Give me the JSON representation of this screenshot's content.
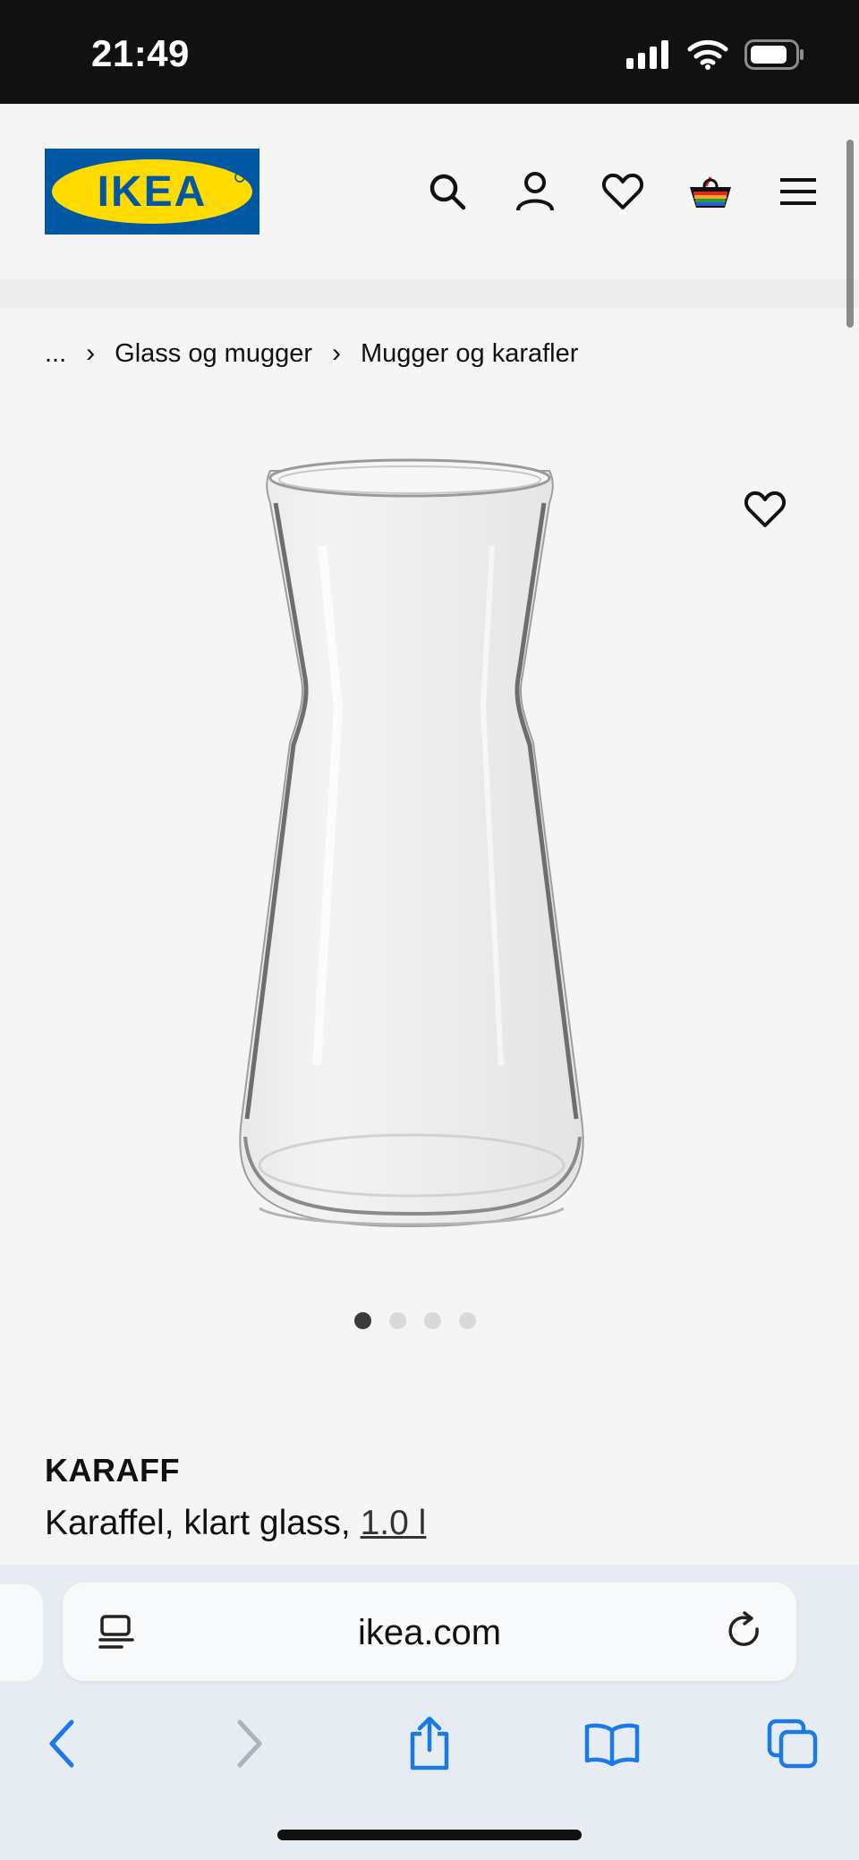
{
  "status_bar": {
    "time": "21:49",
    "icons": [
      "cellular-signal-icon",
      "wifi-icon",
      "battery-icon"
    ]
  },
  "header": {
    "logo_text": "IKEA",
    "icons": [
      "search-icon",
      "account-icon",
      "wishlist-icon",
      "cart-icon",
      "menu-icon"
    ],
    "colors": {
      "logo_blue": "#0058a3",
      "logo_yellow": "#ffdb00"
    }
  },
  "breadcrumb": {
    "items": [
      {
        "label": "..."
      },
      {
        "label": "Glass og mugger"
      },
      {
        "label": "Mugger og karafler"
      }
    ],
    "separator": "›"
  },
  "gallery": {
    "image_alt": "KARAFF carafe",
    "dot_count": 4,
    "active_index": 0
  },
  "product": {
    "name": "KARAFF",
    "description": "Karaffel, klart glass,",
    "size": "1.0 l"
  },
  "browser": {
    "url": "ikea.com",
    "nav_icons": [
      "back-icon",
      "forward-icon",
      "share-icon",
      "bookmarks-icon",
      "tabs-icon"
    ],
    "accent": "#1a7ae6"
  }
}
